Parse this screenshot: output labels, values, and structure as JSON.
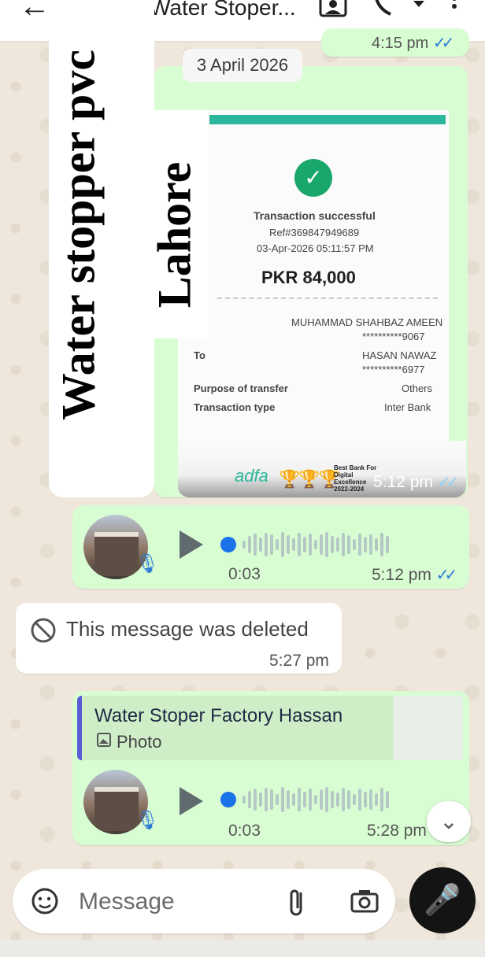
{
  "header": {
    "title": "Water Stoper...",
    "back_icon": "arrow-left-icon",
    "contact_icon": "contact-card-icon",
    "call_icon": "phone-icon",
    "menu_icon": "more-vert-icon"
  },
  "prev_message": {
    "time": "4:15 pm"
  },
  "date_chip": "3 April 2026",
  "overlay_text": {
    "line1": "Water stopper pvc",
    "line2": "Lahore"
  },
  "receipt": {
    "status": "Transaction successful",
    "ref": "Ref#369847949689",
    "datetime": "03-Apr-2026 05:11:57 PM",
    "amount": "PKR 84,000",
    "from_name": "MUHAMMAD SHAHBAZ AMEEN",
    "from_account": "**********9067",
    "to_label": "To",
    "to_name": "HASAN NAWAZ",
    "to_account": "**********6977",
    "purpose_label": "Purpose of transfer",
    "purpose_value": "Others",
    "type_label": "Transaction type",
    "type_value": "Inter Bank",
    "brand": "adfa",
    "award": "Best Bank For Digital Excellence 2022-2024",
    "time": "5:12 pm"
  },
  "voice1": {
    "duration": "0:03",
    "time": "5:12 pm",
    "progress": 0
  },
  "deleted_message": {
    "text": "This message was deleted",
    "time": "5:27 pm",
    "icon": "block-icon"
  },
  "reply": {
    "name": "Water Stoper Factory Hassan",
    "type": "Photo",
    "icon": "image-icon"
  },
  "voice2": {
    "duration": "0:03",
    "time": "5:28 pm",
    "progress": 0
  },
  "composer": {
    "placeholder": "Message",
    "emoji_icon": "sticker-icon",
    "attach_icon": "paperclip-icon",
    "camera_icon": "camera-icon",
    "mic_icon": "mic-icon"
  },
  "colors": {
    "outgoing": "#d9fdd3",
    "incoming": "#ffffff",
    "tick": "#2a7bd6",
    "voice_dot": "#1a73e8"
  }
}
